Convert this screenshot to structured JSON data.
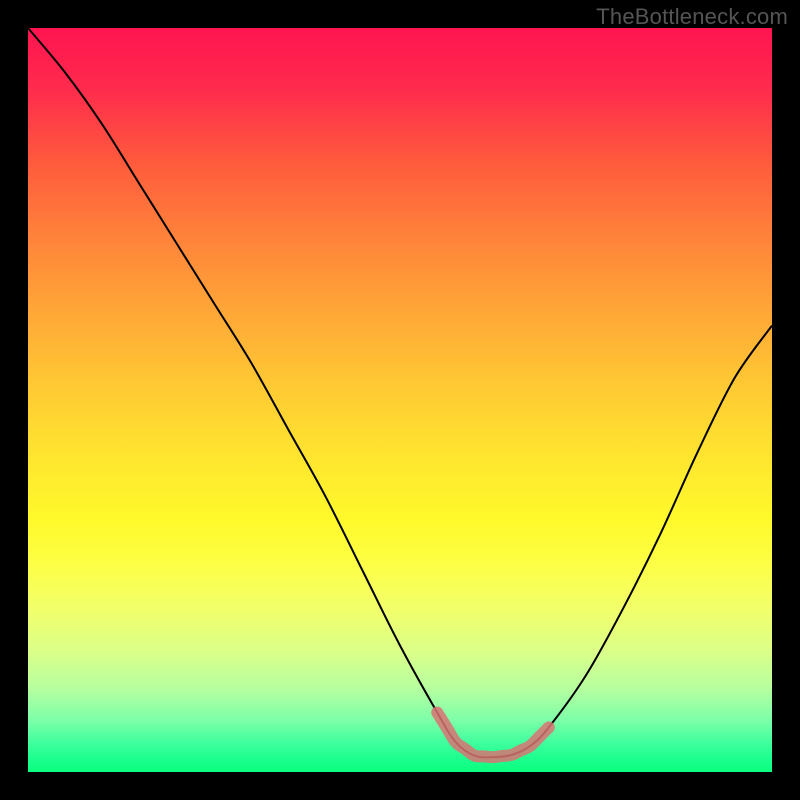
{
  "watermark": "TheBottleneck.com",
  "chart_data": {
    "type": "line",
    "title": "",
    "xlabel": "",
    "ylabel": "",
    "xlim": [
      0,
      100
    ],
    "ylim": [
      0,
      100
    ],
    "grid": false,
    "legend": false,
    "series": [
      {
        "name": "curve",
        "x": [
          0,
          5,
          10,
          15,
          20,
          25,
          30,
          35,
          40,
          45,
          50,
          55,
          57.5,
          60,
          62.5,
          65,
          67.5,
          70,
          75,
          80,
          85,
          90,
          95,
          100
        ],
        "y": [
          100,
          94,
          87,
          79,
          71,
          63,
          55,
          46,
          37,
          27,
          17,
          8,
          4,
          2.2,
          2.0,
          2.3,
          3.5,
          6,
          13,
          22,
          32,
          43,
          53,
          60
        ]
      }
    ],
    "annotations": [
      {
        "type": "band",
        "name": "optimal-region",
        "x_range": [
          55,
          70
        ],
        "approx_y": 2.3,
        "color": "#d97373"
      }
    ],
    "background_gradient": {
      "orientation": "vertical",
      "stops": [
        {
          "pos": 0.0,
          "color": "#ff1450"
        },
        {
          "pos": 0.18,
          "color": "#ff5a3d"
        },
        {
          "pos": 0.38,
          "color": "#ffa637"
        },
        {
          "pos": 0.58,
          "color": "#ffe62f"
        },
        {
          "pos": 0.78,
          "color": "#f2ff6a"
        },
        {
          "pos": 0.93,
          "color": "#7dffa8"
        },
        {
          "pos": 1.0,
          "color": "#0aff7e"
        }
      ]
    }
  }
}
